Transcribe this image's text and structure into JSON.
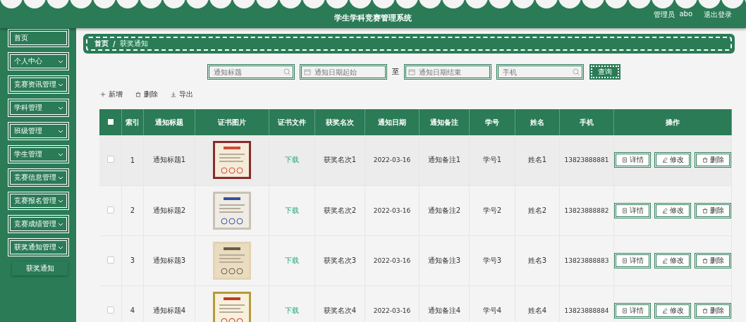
{
  "header": {
    "title": "学生学科竞赛管理系统",
    "user_role": "管理员",
    "username": "abo",
    "logout": "退出登录"
  },
  "sidebar": {
    "items": [
      {
        "kind": "link",
        "label": "首页"
      },
      {
        "kind": "menu",
        "label": "个人中心"
      },
      {
        "kind": "menu",
        "label": "竞赛资讯管理"
      },
      {
        "kind": "menu",
        "label": "学科管理"
      },
      {
        "kind": "menu",
        "label": "班级管理"
      },
      {
        "kind": "menu",
        "label": "学生管理"
      },
      {
        "kind": "menu",
        "label": "竞赛信息管理"
      },
      {
        "kind": "menu",
        "label": "竞赛报名管理"
      },
      {
        "kind": "menu",
        "label": "竞赛成绩管理"
      },
      {
        "kind": "menu",
        "label": "获奖通知管理",
        "children": [
          {
            "label": "获奖通知"
          }
        ]
      }
    ]
  },
  "breadcrumb": {
    "items": [
      "首页",
      "获奖通知"
    ],
    "separator": "/"
  },
  "search": {
    "title_field": {
      "placeholder": "通知标题"
    },
    "date_from": {
      "placeholder": "通知日期起始"
    },
    "range_separator": "至",
    "date_to": {
      "placeholder": "通知日期结束"
    },
    "phone_field": {
      "placeholder": "手机"
    },
    "button": "查询"
  },
  "toolbar": [
    {
      "kind": "add",
      "label": "新增"
    },
    {
      "kind": "delete",
      "label": "删除"
    },
    {
      "kind": "export",
      "label": "导出"
    }
  ],
  "table": {
    "select_all_checked": false,
    "columns": [
      "索引",
      "通知标题",
      "证书图片",
      "证书文件",
      "获奖名次",
      "通知日期",
      "通知备注",
      "学号",
      "姓名",
      "手机",
      "操作"
    ],
    "rows": [
      {
        "checked": false,
        "index": "1",
        "title": "通知标题1",
        "file": "下载",
        "rank": "获奖名次1",
        "date": "2022-03-16",
        "note": "通知备注1",
        "student_no": "学号1",
        "name": "姓名1",
        "phone": "13823888881",
        "actions": [
          {
            "kind": "detail",
            "label": "详情"
          },
          {
            "kind": "edit",
            "label": "修改"
          },
          {
            "kind": "delete",
            "label": "删除"
          }
        ]
      },
      {
        "checked": false,
        "index": "2",
        "title": "通知标题2",
        "file": "下载",
        "rank": "获奖名次2",
        "date": "2022-03-16",
        "note": "通知备注2",
        "student_no": "学号2",
        "name": "姓名2",
        "phone": "13823888882",
        "actions": [
          {
            "kind": "detail",
            "label": "详情"
          },
          {
            "kind": "edit",
            "label": "修改"
          },
          {
            "kind": "delete",
            "label": "删除"
          }
        ]
      },
      {
        "checked": false,
        "index": "3",
        "title": "通知标题3",
        "file": "下载",
        "rank": "获奖名次3",
        "date": "2022-03-16",
        "note": "通知备注3",
        "student_no": "学号3",
        "name": "姓名3",
        "phone": "13823888883",
        "actions": [
          {
            "kind": "detail",
            "label": "详情"
          },
          {
            "kind": "edit",
            "label": "修改"
          },
          {
            "kind": "delete",
            "label": "删除"
          }
        ]
      },
      {
        "checked": false,
        "index": "4",
        "title": "通知标题4",
        "file": "下载",
        "rank": "获奖名次4",
        "date": "2022-03-16",
        "note": "通知备注4",
        "student_no": "学号4",
        "name": "姓名4",
        "phone": "13823888884",
        "actions": [
          {
            "kind": "detail",
            "label": "详情"
          },
          {
            "kind": "edit",
            "label": "修改"
          },
          {
            "kind": "delete",
            "label": "删除"
          }
        ]
      }
    ]
  }
}
